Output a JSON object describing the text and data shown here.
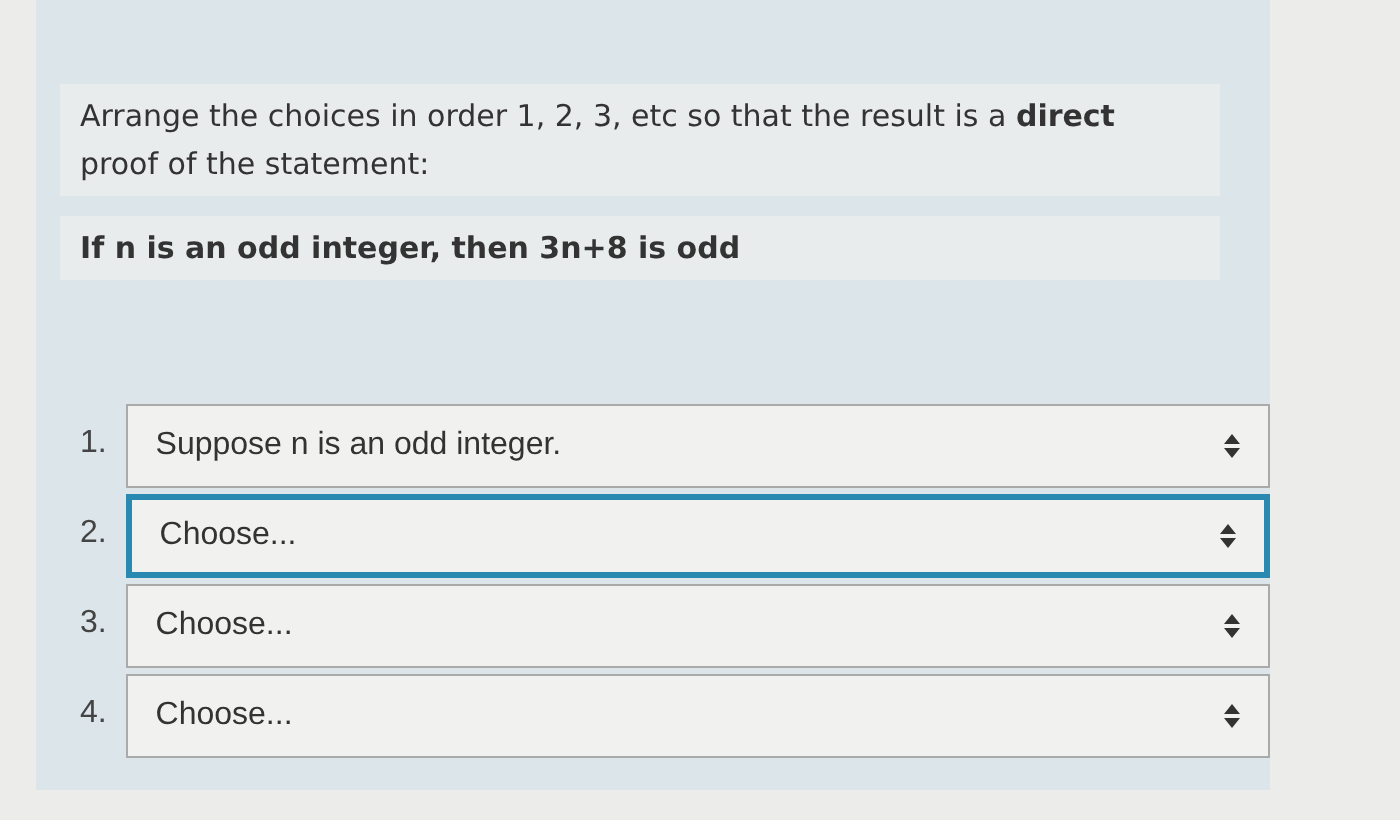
{
  "question": {
    "prompt": "Arrange the choices in order 1, 2, 3, etc so that the result is a **direct** proof of the statement:",
    "statement": "If n is an odd integer, then 3n+8 is odd"
  },
  "answers": [
    {
      "number": "1.",
      "value": "Suppose n is an odd integer.",
      "focused": false
    },
    {
      "number": "2.",
      "value": "Choose...",
      "focused": true
    },
    {
      "number": "3.",
      "value": "Choose...",
      "focused": false
    },
    {
      "number": "4.",
      "value": "Choose...",
      "focused": false
    }
  ]
}
